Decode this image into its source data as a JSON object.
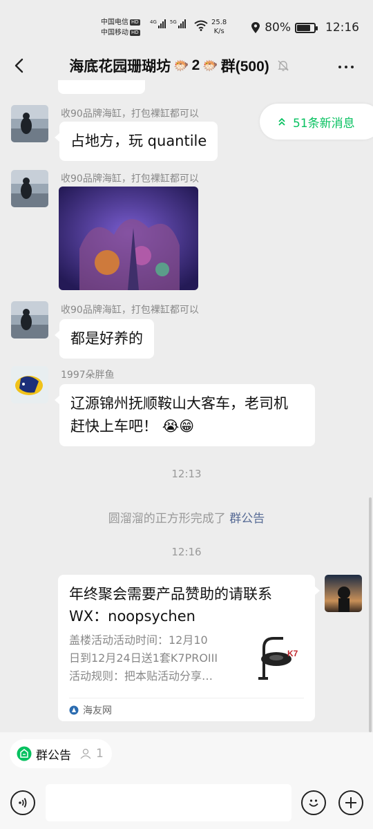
{
  "status_bar": {
    "carrier1": "中国电信",
    "carrier2": "中国移动",
    "hd_badge": "HD",
    "net_speed_value": "25.8",
    "net_speed_unit": "K/s",
    "battery_percent": "80%",
    "battery_level": 0.8,
    "time": "12:16"
  },
  "header": {
    "title_part1": "海底花园珊瑚坊",
    "title_part2": "2",
    "title_part3": "群(500)",
    "title_emoji": "🐡"
  },
  "new_messages": {
    "label": "51条新消息"
  },
  "messages": [
    {
      "sender": "收90品牌海缸，打包裸缸都可以",
      "text": "占地方，玩 quantile"
    },
    {
      "sender": "收90品牌海缸，打包裸缸都可以",
      "image": "coral-photo"
    },
    {
      "sender": "收90品牌海缸，打包裸缸都可以",
      "text": "都是好养的"
    },
    {
      "sender": "1997朵胖鱼",
      "text_line1": "辽源锦州抚顺鞍山大客车，老司机",
      "text_line2": "赶快上车吧！",
      "emojis": "😭😁"
    }
  ],
  "time_1": "12:13",
  "system_message": {
    "prefix": "圆溜溜的正方形完成了",
    "link": "群公告"
  },
  "time_2": "12:16",
  "card": {
    "title_line1": "年终聚会需要产品赞助的请联系",
    "title_line2": "WX：noopsychen",
    "desc_line1": "盖楼活动活动时间：12月10",
    "desc_line2": "日到12月24日送1套K7PROIII",
    "desc_line3": "活动规则：把本贴活动分享…",
    "source": "海友网"
  },
  "bottom": {
    "announcement_label": "群公告",
    "member_count": "1"
  }
}
